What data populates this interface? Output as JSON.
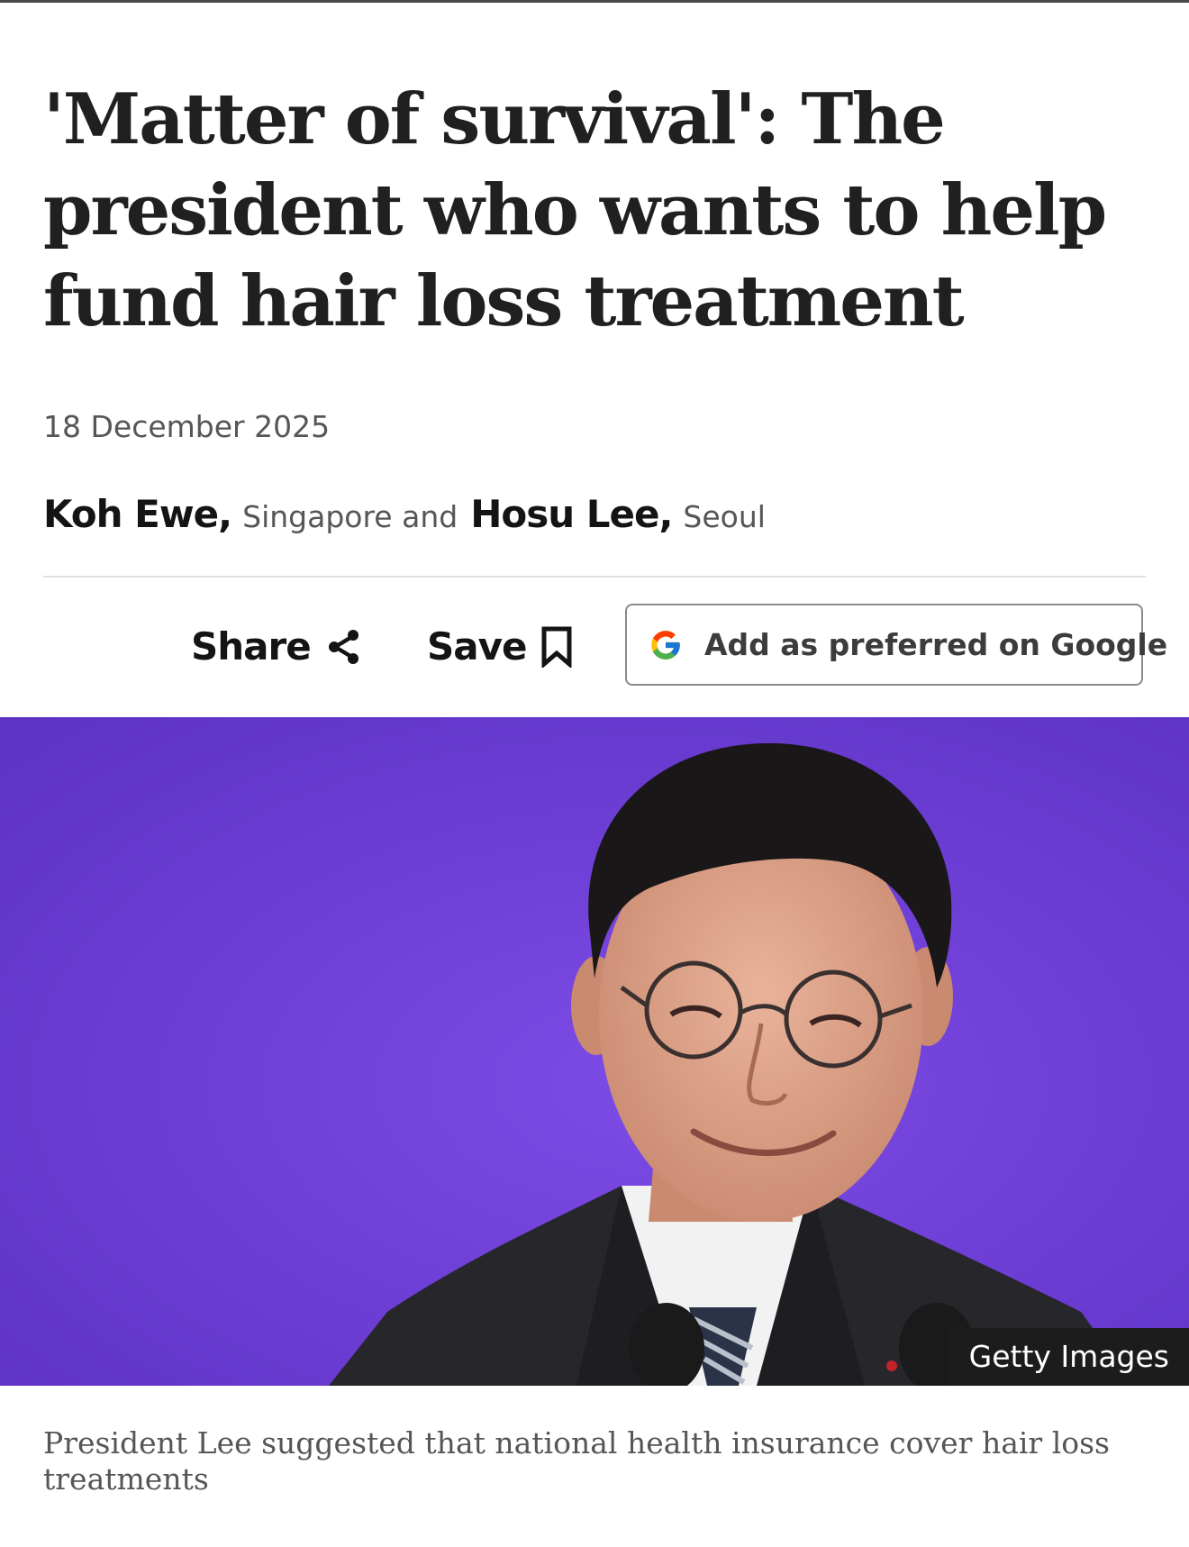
{
  "article": {
    "headline": "'Matter of survival': The president who wants to help fund hair loss treatment",
    "date": "18 December 2025",
    "authors": [
      {
        "name": "Koh Ewe,",
        "location": "Singapore and"
      },
      {
        "name": "Hosu Lee,",
        "location": "Seoul"
      }
    ]
  },
  "toolbar": {
    "share_label": "Share",
    "save_label": "Save",
    "google_label": "Add as preferred on Google"
  },
  "image": {
    "credit": "Getty Images",
    "caption": "President Lee suggested that national health insurance cover hair loss treatments"
  },
  "colors": {
    "headline": "#202020",
    "meta": "#545658",
    "photo_background": "#6a3fd4"
  }
}
